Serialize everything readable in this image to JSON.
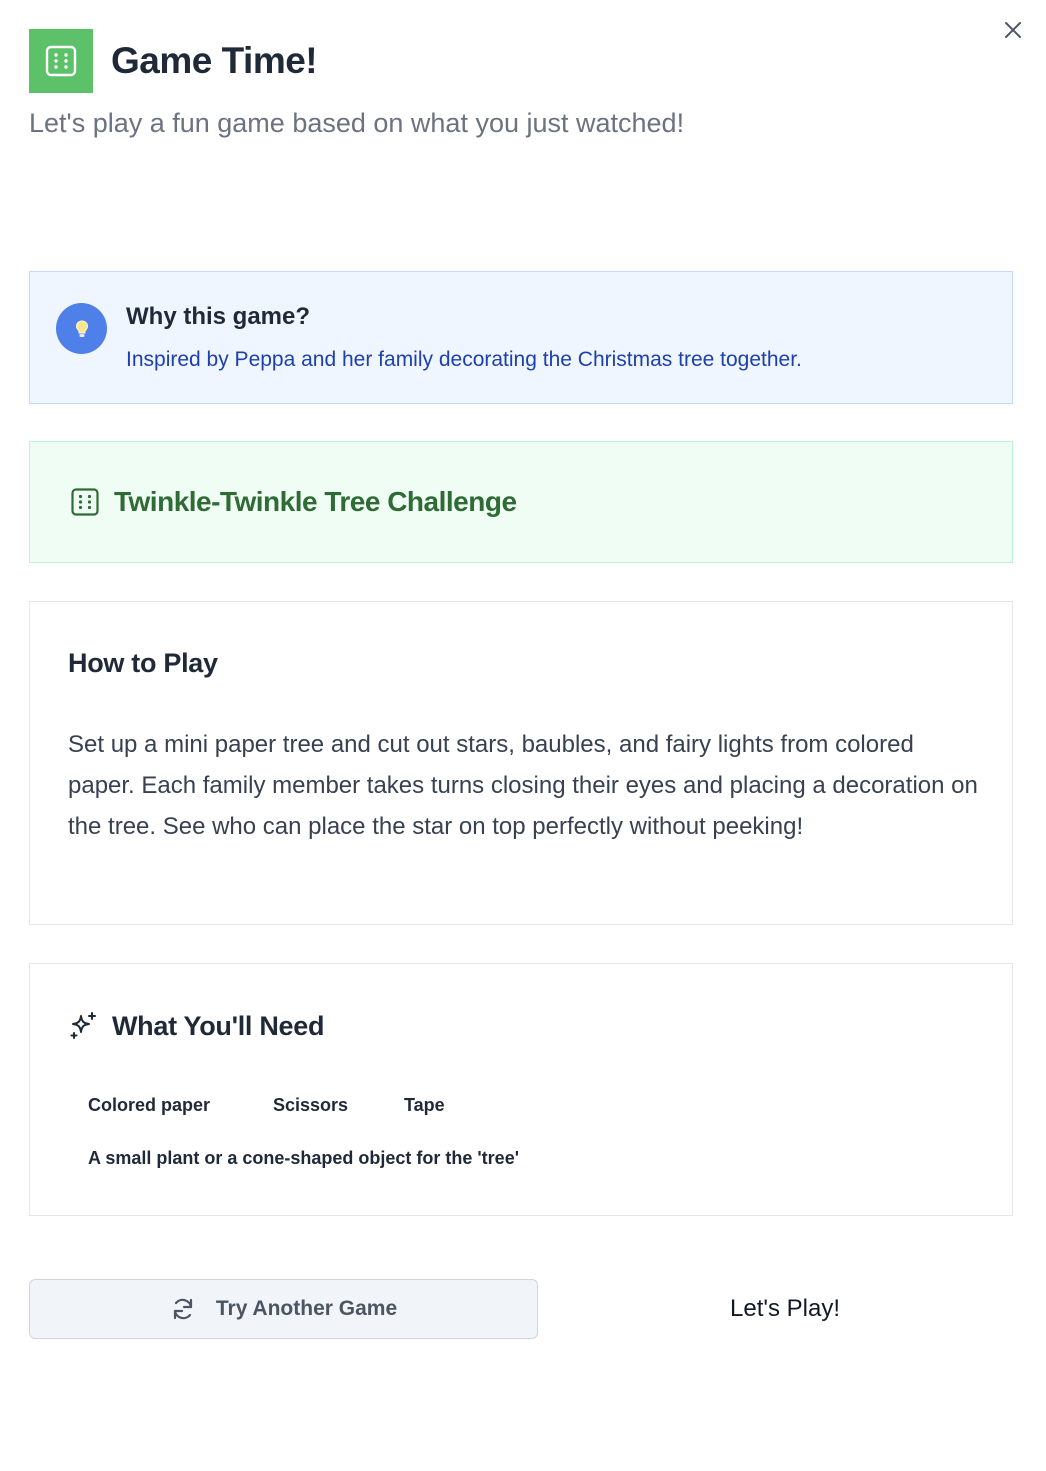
{
  "header": {
    "title": "Game Time!",
    "subtitle": "Let's play a fun game based on what you just watched!"
  },
  "why": {
    "title": "Why this game?",
    "text": "Inspired by Peppa and her family decorating the Christmas tree together."
  },
  "game": {
    "title": "Twinkle-Twinkle Tree Challenge"
  },
  "how_to_play": {
    "title": "How to Play",
    "text": "Set up a mini paper tree and cut out stars, baubles, and fairy lights from colored paper. Each family member takes turns closing their eyes and placing a decoration on the tree. See who can place the star on top perfectly without peeking!"
  },
  "needs": {
    "title": "What You'll Need",
    "items": [
      "Colored paper",
      "Scissors",
      "Tape",
      "A small plant or a cone-shaped object for the 'tree'"
    ]
  },
  "actions": {
    "try_another": "Try Another Game",
    "lets_play": "Let's Play!"
  },
  "icons": {
    "close": "close-icon",
    "header": "dice-icon",
    "why": "lightbulb-icon",
    "game": "dice-icon",
    "needs": "sparkles-icon",
    "try": "refresh-icon"
  },
  "colors": {
    "header_icon_bg": "#5cc169",
    "why_bg": "#eff6ff",
    "why_text": "#1e40af",
    "why_icon_bg": "#4f80e9",
    "game_bg": "#f0fdf4",
    "game_title": "#2f6b35"
  }
}
